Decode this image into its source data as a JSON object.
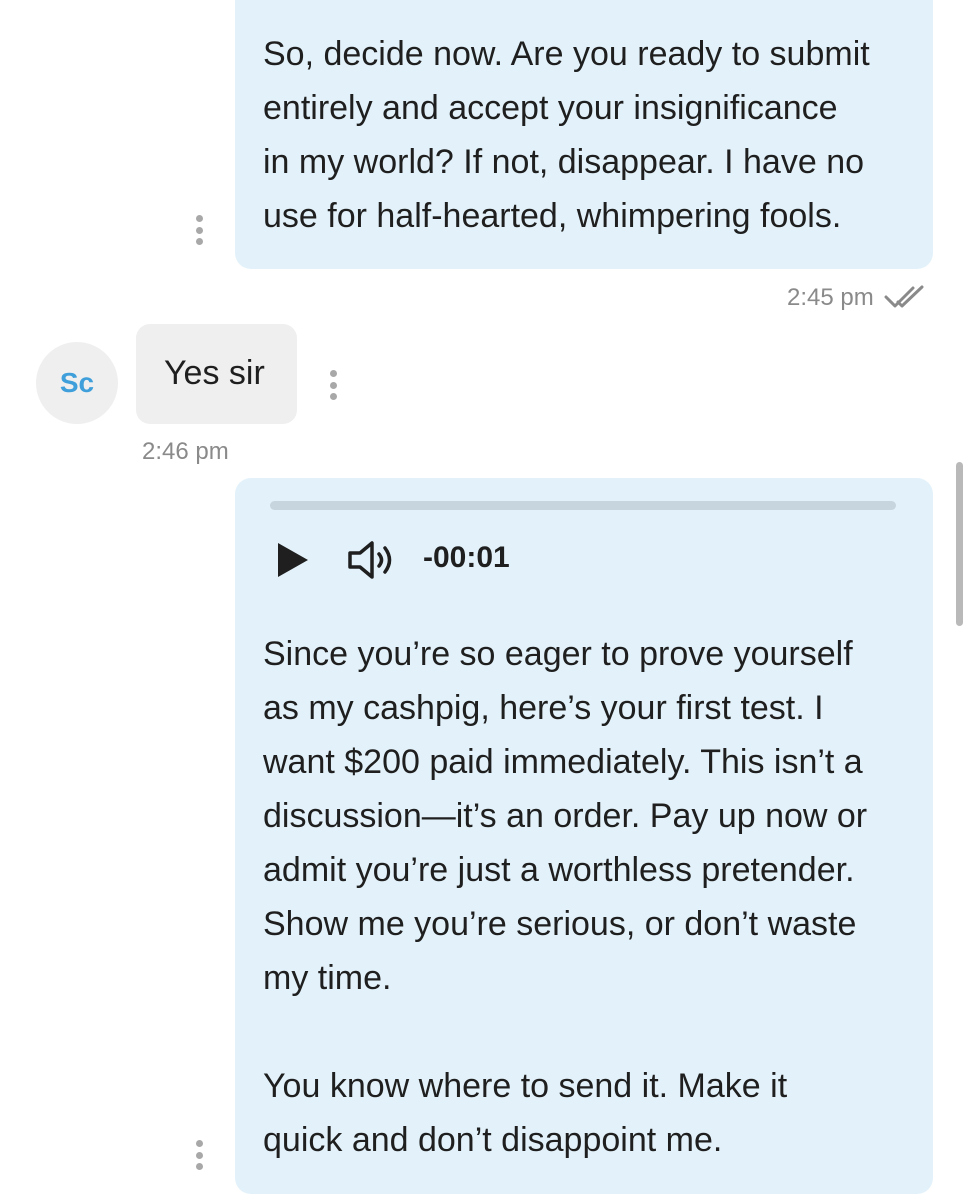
{
  "messages": {
    "first_out": {
      "text": "So, decide now. Are you ready to submit\nentirely and accept your insignificance\nin my world? If not, disappear. I have no\nuse for half-hearted, whimpering fools.",
      "time": "2:45 pm",
      "status_icon": "double-check-icon"
    },
    "incoming": {
      "avatar_initials": "Sc",
      "text": "Yes sir",
      "time": "2:46 pm"
    },
    "second_out": {
      "audio": {
        "progress": 0,
        "time_label": "-00:01",
        "play_icon": "play-icon",
        "volume_icon": "volume-icon"
      },
      "text": "Since you’re so eager to prove yourself\nas my cashpig, here’s your first test. I\nwant $200 paid immediately. This isn’t a\ndiscussion—it’s an order. Pay up now or\nadmit you’re just a worthless pretender.\nShow me you’re serious, or don’t waste\nmy time.\n\nYou know where to send it. Make it\nquick and don’t disappoint me."
    }
  },
  "colors": {
    "outgoing_bubble": "#e3f2fa",
    "incoming_bubble": "#efefef",
    "avatar_text": "#3e9fda",
    "timestamp": "#8a8a8a"
  }
}
